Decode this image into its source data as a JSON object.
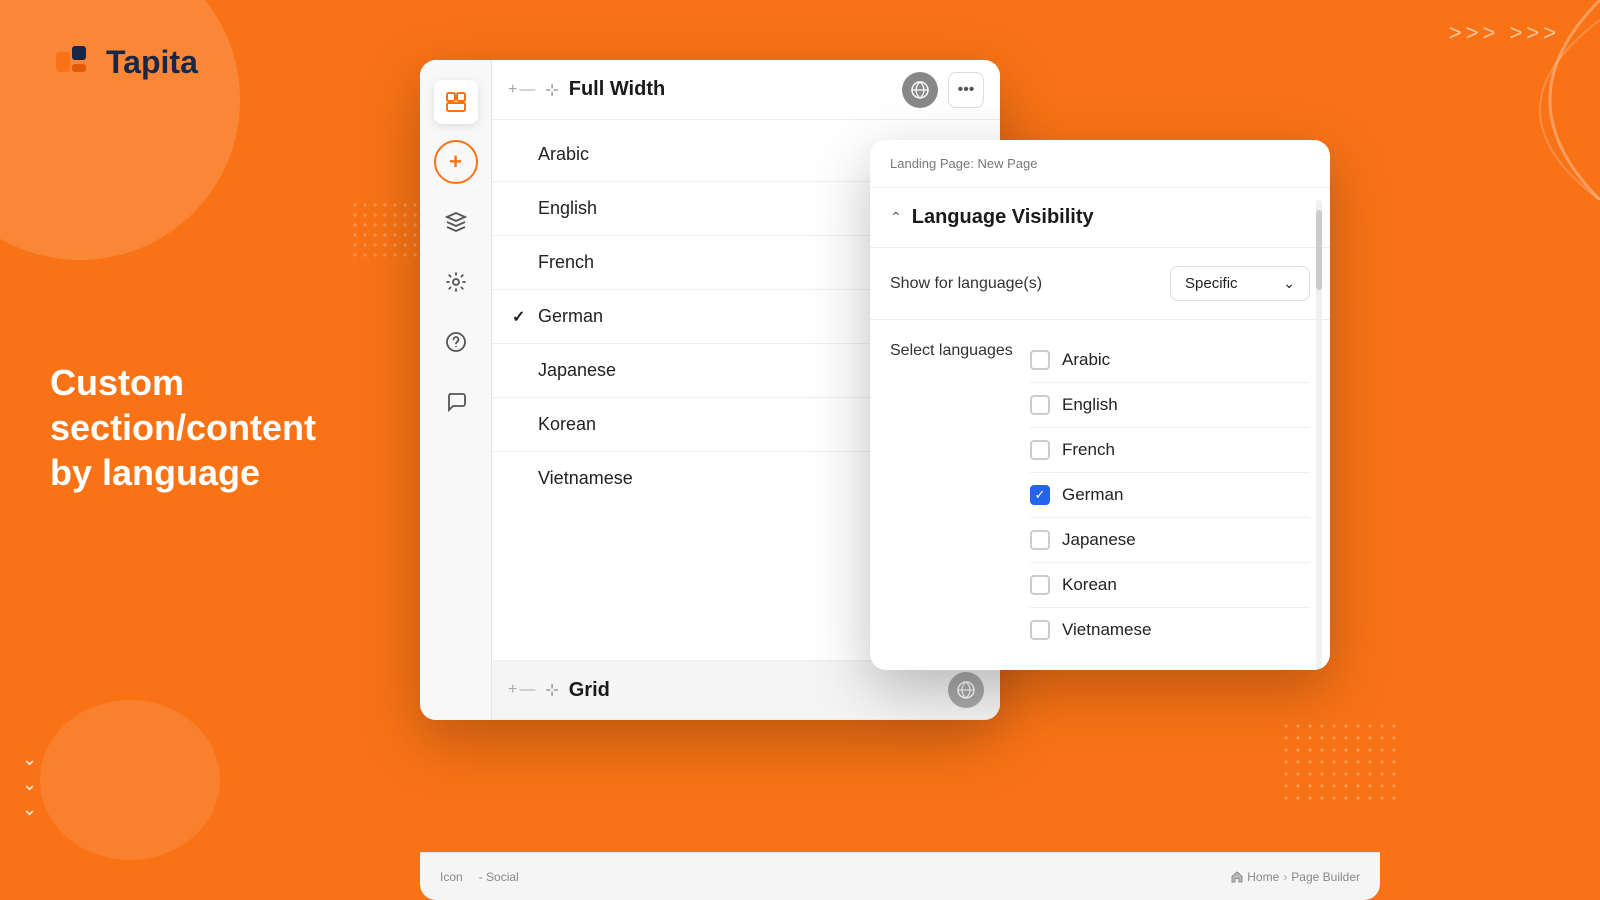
{
  "background": {
    "color": "#F97316"
  },
  "logo": {
    "text": "Tapita"
  },
  "headline": {
    "line1": "Custom",
    "line2": "section/content",
    "line3": "by language"
  },
  "arrows_top_right": ">>> >>>",
  "page_builder": {
    "sections": [
      {
        "title": "Full Width",
        "id": "full-width"
      },
      {
        "title": "Grid",
        "id": "grid"
      }
    ],
    "languages": [
      {
        "name": "Arabic",
        "checked": false
      },
      {
        "name": "English",
        "checked": false
      },
      {
        "name": "French",
        "checked": false
      },
      {
        "name": "German",
        "checked": true
      },
      {
        "name": "Japanese",
        "checked": false
      },
      {
        "name": "Korean",
        "checked": false
      },
      {
        "name": "Vietnamese",
        "checked": false
      }
    ]
  },
  "language_visibility": {
    "header_text": "Landing Page: New Page",
    "title": "Language Visibility",
    "show_for_label": "Show for language(s)",
    "dropdown_value": "Specific",
    "select_languages_label": "Select languages",
    "languages": [
      {
        "name": "Arabic",
        "checked": false
      },
      {
        "name": "English",
        "checked": false
      },
      {
        "name": "French",
        "checked": false
      },
      {
        "name": "German",
        "checked": true
      },
      {
        "name": "Japanese",
        "checked": false
      },
      {
        "name": "Korean",
        "checked": false
      },
      {
        "name": "Vietnamese",
        "checked": false
      }
    ]
  },
  "bottom_bar": {
    "icon_label": "Icon",
    "social_label": "- Social",
    "breadcrumb": [
      "Home",
      "Page Builder"
    ]
  },
  "sidebar": {
    "icons": [
      {
        "id": "layout-icon",
        "symbol": "⊟",
        "active": true
      },
      {
        "id": "add-icon",
        "symbol": "+",
        "active": false
      },
      {
        "id": "layers-icon",
        "symbol": "≡",
        "active": false
      },
      {
        "id": "settings-icon",
        "symbol": "⚙",
        "active": false
      },
      {
        "id": "help-icon",
        "symbol": "?",
        "active": false
      },
      {
        "id": "chat-icon",
        "symbol": "◯",
        "active": false
      }
    ]
  }
}
